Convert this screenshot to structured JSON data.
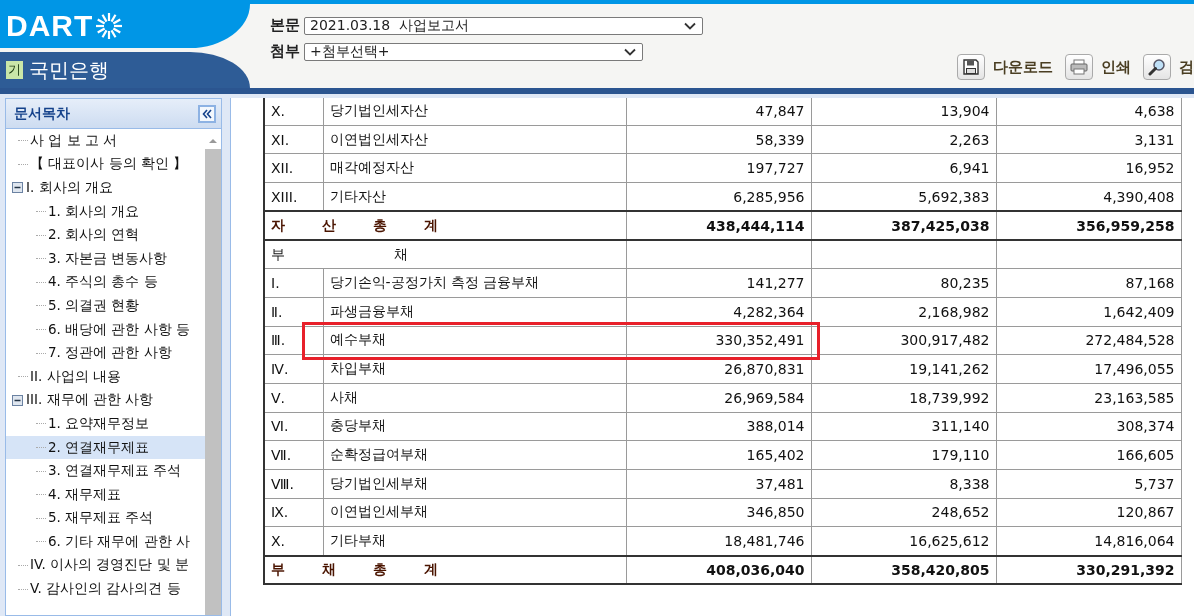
{
  "logo": "DART",
  "company": {
    "badge": "기",
    "name": "국민은행"
  },
  "document": {
    "label": "본문",
    "value": "2021.03.18  사업보고서"
  },
  "attachment": {
    "label": "첨부",
    "value": "+첨부선택+"
  },
  "toolbar": [
    {
      "kind": "download",
      "label": "다운로드"
    },
    {
      "kind": "print",
      "label": "인쇄"
    },
    {
      "kind": "search",
      "label": "검"
    }
  ],
  "sidebar": {
    "title": "문서목차",
    "items": [
      {
        "label": "사 업 보 고 서",
        "selected": false
      },
      {
        "label": "【 대표이사 등의 확인 】",
        "selected": false
      },
      {
        "label": "I. 회사의 개요",
        "selected": false,
        "expanded": true,
        "children": [
          {
            "label": "1. 회사의 개요",
            "selected": false
          },
          {
            "label": "2. 회사의 연혁",
            "selected": false
          },
          {
            "label": "3. 자본금 변동사항",
            "selected": false
          },
          {
            "label": "4. 주식의 총수 등",
            "selected": false
          },
          {
            "label": "5. 의결권 현황",
            "selected": false
          },
          {
            "label": "6. 배당에 관한 사항 등",
            "selected": false
          },
          {
            "label": "7. 정관에 관한 사항",
            "selected": false
          }
        ]
      },
      {
        "label": "II. 사업의 내용",
        "selected": false
      },
      {
        "label": "III. 재무에 관한 사항",
        "selected": false,
        "expanded": true,
        "children": [
          {
            "label": "1. 요약재무정보",
            "selected": false
          },
          {
            "label": "2. 연결재무제표",
            "selected": true
          },
          {
            "label": "3. 연결재무제표 주석",
            "selected": false
          },
          {
            "label": "4. 재무제표",
            "selected": false
          },
          {
            "label": "5. 재무제표 주석",
            "selected": false
          },
          {
            "label": "6. 기타 재무에 관한 사",
            "selected": false
          }
        ]
      },
      {
        "label": "IV. 이사의 경영진단 및 분",
        "selected": false
      },
      {
        "label": "V. 감사인의 감사의견 등",
        "selected": false
      }
    ]
  },
  "table": {
    "rows": [
      {
        "kind": "item",
        "numeral": "X.",
        "name": "당기법인세자산",
        "values": [
          "47,847",
          "13,904",
          "4,638"
        ],
        "highlighted": false
      },
      {
        "kind": "item",
        "numeral": "XI.",
        "name": "이연법인세자산",
        "values": [
          "58,339",
          "2,263",
          "3,131"
        ],
        "highlighted": false
      },
      {
        "kind": "item",
        "numeral": "XII.",
        "name": "매각예정자산",
        "values": [
          "197,727",
          "6,941",
          "16,952"
        ],
        "highlighted": false
      },
      {
        "kind": "item",
        "numeral": "XIII.",
        "name": "기타자산",
        "values": [
          "6,285,956",
          "5,692,383",
          "4,390,408"
        ],
        "highlighted": false
      },
      {
        "kind": "total",
        "name": "자 산 총 계",
        "values": [
          "438,444,114",
          "387,425,038",
          "356,959,258"
        ]
      },
      {
        "kind": "section",
        "name": "부 채"
      },
      {
        "kind": "item",
        "numeral": "Ⅰ.",
        "name": "당기손익-공정가치 측정 금융부채",
        "values": [
          "141,277",
          "80,235",
          "87,168"
        ],
        "highlighted": false
      },
      {
        "kind": "item",
        "numeral": "Ⅱ.",
        "name": "파생금융부채",
        "values": [
          "4,282,364",
          "2,168,982",
          "1,642,409"
        ],
        "highlighted": false
      },
      {
        "kind": "item",
        "numeral": "Ⅲ.",
        "name": "예수부채",
        "values": [
          "330,352,491",
          "300,917,482",
          "272,484,528"
        ],
        "highlighted": true
      },
      {
        "kind": "item",
        "numeral": "Ⅳ.",
        "name": "차입부채",
        "values": [
          "26,870,831",
          "19,141,262",
          "17,496,055"
        ],
        "highlighted": false
      },
      {
        "kind": "item",
        "numeral": "Ⅴ.",
        "name": "사채",
        "values": [
          "26,969,584",
          "18,739,992",
          "23,163,585"
        ],
        "highlighted": false
      },
      {
        "kind": "item",
        "numeral": "Ⅵ.",
        "name": "충당부채",
        "values": [
          "388,014",
          "311,140",
          "308,374"
        ],
        "highlighted": false
      },
      {
        "kind": "item",
        "numeral": "Ⅶ.",
        "name": "순확정급여부채",
        "values": [
          "165,402",
          "179,110",
          "166,605"
        ],
        "highlighted": false
      },
      {
        "kind": "item",
        "numeral": "Ⅷ.",
        "name": "당기법인세부채",
        "values": [
          "37,481",
          "8,338",
          "5,737"
        ],
        "highlighted": false
      },
      {
        "kind": "item",
        "numeral": "Ⅸ.",
        "name": "이연법인세부채",
        "values": [
          "346,850",
          "248,652",
          "120,867"
        ],
        "highlighted": false
      },
      {
        "kind": "item",
        "numeral": "X.",
        "name": "기타부채",
        "values": [
          "18,481,746",
          "16,625,612",
          "14,816,064"
        ],
        "highlighted": false
      },
      {
        "kind": "total",
        "name": "부 채 총 계",
        "values": [
          "408,036,040",
          "358,420,805",
          "330,291,392"
        ]
      }
    ]
  }
}
